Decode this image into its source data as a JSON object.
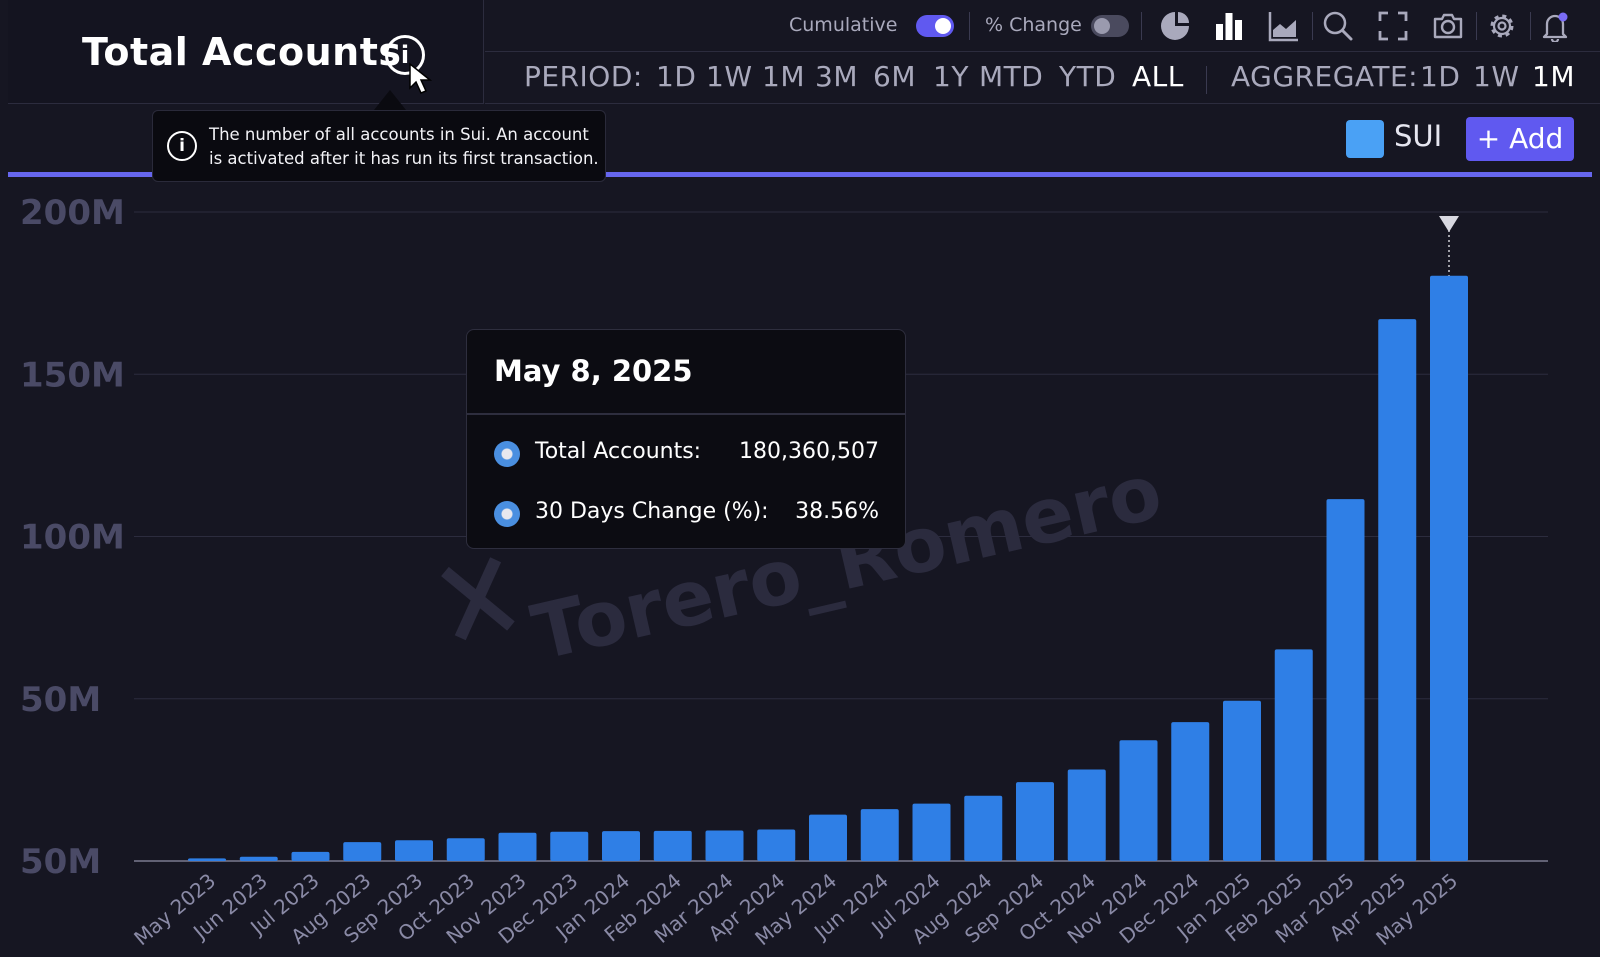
{
  "header": {
    "title": "Total Accounts"
  },
  "toolbar": {
    "cumulative_label": "Cumulative",
    "cumulative_on": true,
    "pct_change_label": "% Change",
    "pct_change_on": false,
    "icons": [
      "pie-chart-icon",
      "bar-chart-icon",
      "area-chart-icon",
      "search-icon",
      "fullscreen-icon",
      "camera-icon",
      "settings-icon",
      "bell-icon"
    ]
  },
  "period": {
    "label": "PERIOD:",
    "options": [
      "1D",
      "1W",
      "1M",
      "3M",
      "6M",
      "1Y",
      "MTD",
      "YTD",
      "ALL"
    ],
    "selected": "ALL"
  },
  "aggregate": {
    "label": "AGGREGATE:",
    "options": [
      "1D",
      "1W",
      "1M"
    ],
    "selected": "1M"
  },
  "series_legend": {
    "name": "SUI",
    "color": "#4aa1f5",
    "add_label": "+ Add"
  },
  "info_tooltip": {
    "text": "The number of all accounts in Sui. An account is activated after it has run its first transaction."
  },
  "hover_tooltip": {
    "date": "May 8, 2025",
    "rows": [
      {
        "name": "Total Accounts:",
        "value": "180,360,507"
      },
      {
        "name": "30 Days Change (%):",
        "value": "38.56%"
      }
    ]
  },
  "watermark": "Torero_Romero",
  "chart_data": {
    "type": "bar",
    "bar_color": "#2f7fe6",
    "y_ticks": [
      "50M",
      "50M",
      "100M",
      "150M",
      "200M"
    ],
    "y_tick_values": [
      0,
      50000000,
      100000000,
      150000000,
      200000000
    ],
    "ylim": [
      0,
      200000000
    ],
    "grid": true,
    "categories": [
      "May 2023",
      "Jun 2023",
      "Jul 2023",
      "Aug 2023",
      "Sep 2023",
      "Oct 2023",
      "Nov 2023",
      "Dec 2023",
      "Jan 2024",
      "Feb 2024",
      "Mar 2024",
      "Apr 2024",
      "May 2024",
      "Jun 2024",
      "Jul 2024",
      "Aug 2024",
      "Sep 2024",
      "Oct 2024",
      "Nov 2024",
      "Dec 2024",
      "Jan 2025",
      "Feb 2025",
      "Mar 2025",
      "Apr 2025",
      "May 2025"
    ],
    "values": [
      800000,
      1300000,
      2800000,
      5800000,
      6400000,
      7000000,
      8700000,
      9000000,
      9200000,
      9300000,
      9400000,
      9700000,
      14300000,
      16000000,
      17700000,
      20100000,
      24300000,
      28200000,
      37200000,
      42800000,
      49400000,
      65200000,
      111500000,
      167000000,
      180360507
    ],
    "highlighted": "May 2025"
  }
}
